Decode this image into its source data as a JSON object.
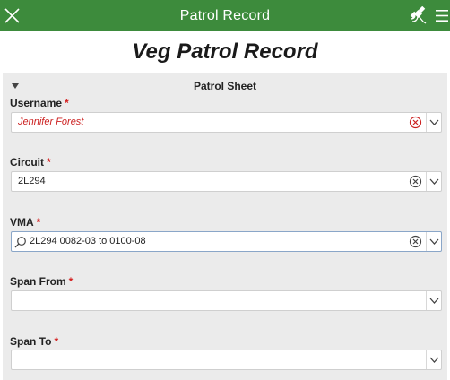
{
  "app_bar": {
    "title": "Patrol Record",
    "close_icon": "close-icon",
    "satellite_icon": "satellite-icon",
    "menu_icon": "hamburger-menu-icon"
  },
  "form": {
    "title": "Veg Patrol Record"
  },
  "section": {
    "label": "Patrol Sheet"
  },
  "fields": {
    "username": {
      "label": "Username",
      "required": "*",
      "value": "Jennifer Forest"
    },
    "circuit": {
      "label": "Circuit",
      "required": "*",
      "value": "2L294"
    },
    "vma": {
      "label": "VMA",
      "required": "*",
      "value": "2L294 0082-03 to 0100-08"
    },
    "span_from": {
      "label": "Span From",
      "required": "*",
      "value": ""
    },
    "span_to": {
      "label": "Span To",
      "required": "*",
      "value": ""
    }
  },
  "colors": {
    "app_bar": "#3d8b3c",
    "required_asterisk": "#d42020",
    "error_text": "#cc2222",
    "panel_bg": "#ebebeb"
  }
}
